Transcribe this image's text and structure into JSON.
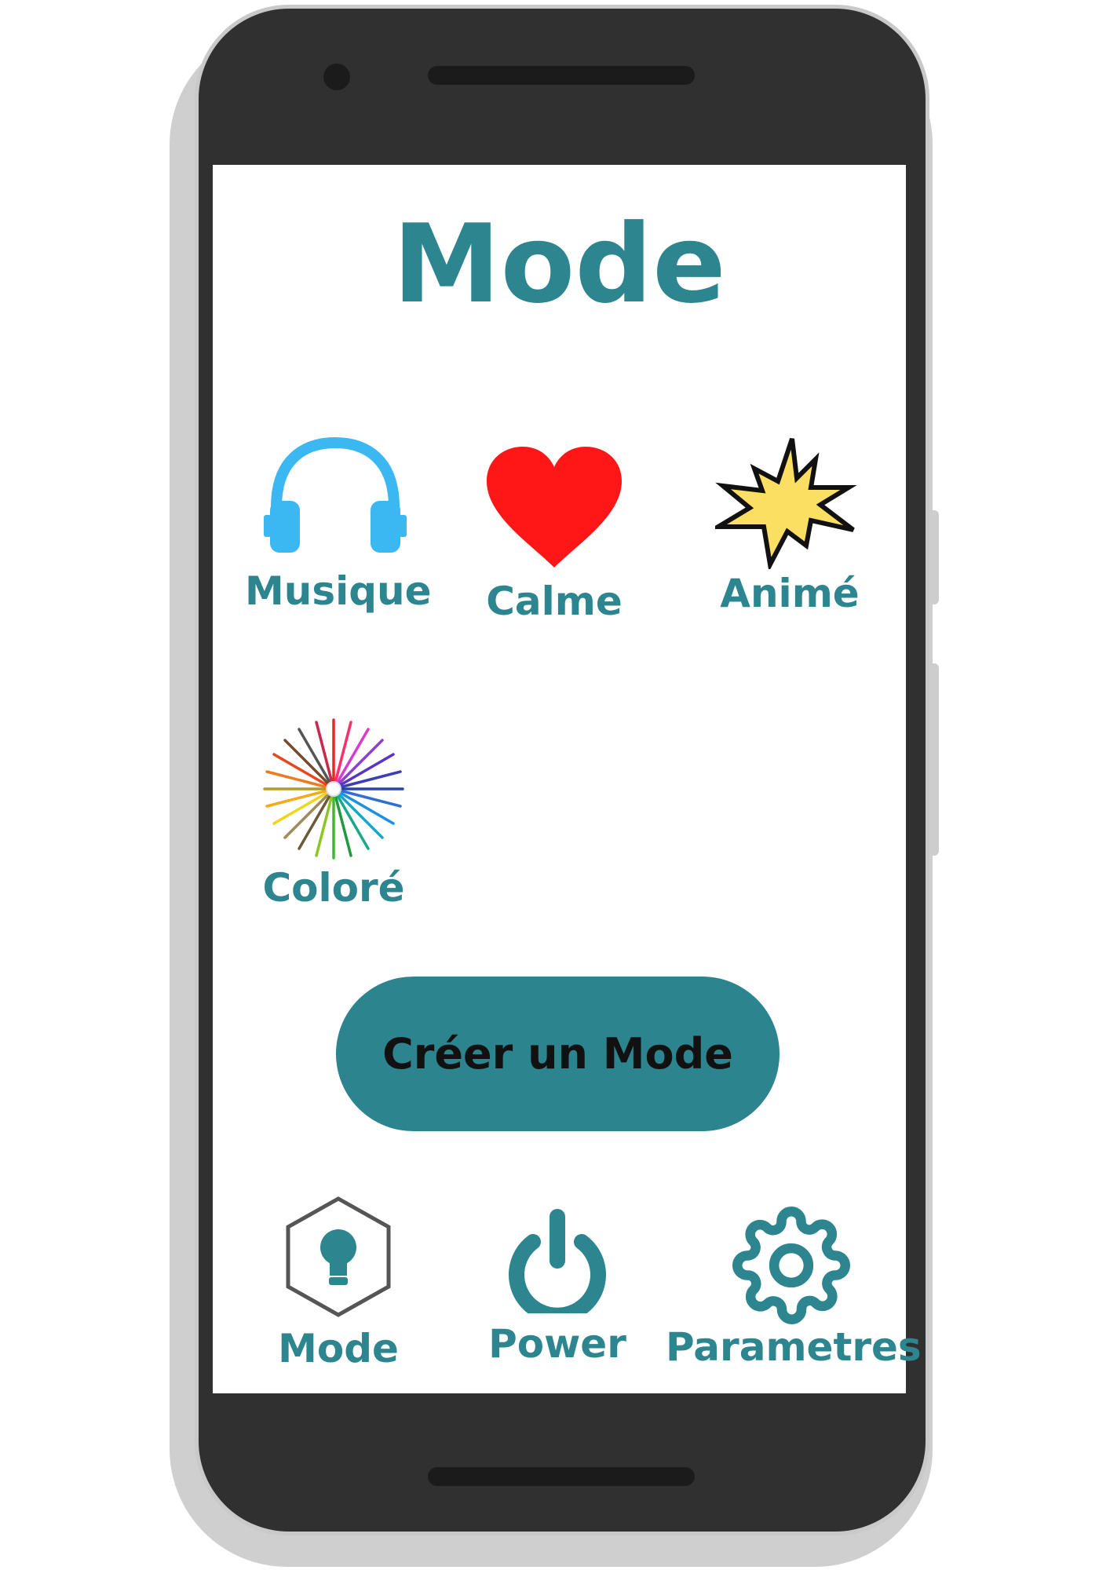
{
  "screen": {
    "title": "Mode"
  },
  "modes": [
    {
      "label": "Musique",
      "icon": "headphones-icon",
      "color": "#3bb7f2"
    },
    {
      "label": "Calme",
      "icon": "heart-icon",
      "color": "#ff1717"
    },
    {
      "label": "Animé",
      "icon": "burst-icon",
      "color": "#fbdf63"
    },
    {
      "label": "Coloré",
      "icon": "color-pencils-icon"
    }
  ],
  "create_button": {
    "label": "Créer un Mode"
  },
  "nav": [
    {
      "label": "Mode",
      "icon": "lightbulb-hexagon-icon"
    },
    {
      "label": "Power",
      "icon": "power-icon"
    },
    {
      "label": "Parametres",
      "icon": "gear-icon"
    }
  ],
  "colors": {
    "accent": "#2c858f",
    "button": "#2c848e",
    "phone_body": "#303030"
  }
}
